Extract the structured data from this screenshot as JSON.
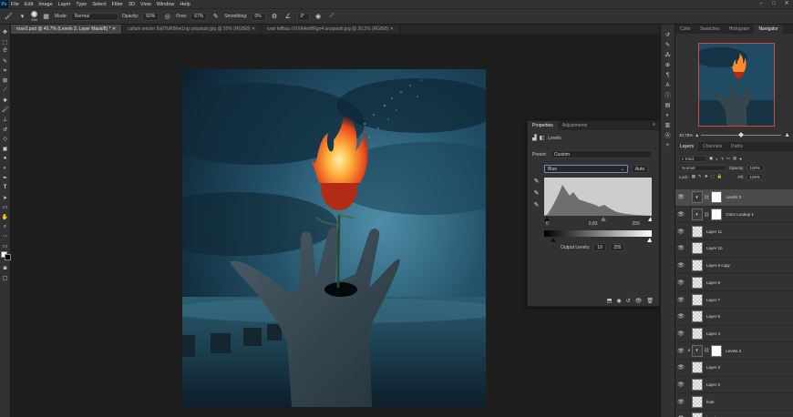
{
  "menubar": {
    "logo": "Ps",
    "items": [
      "File",
      "Edit",
      "Image",
      "Layer",
      "Type",
      "Select",
      "Filter",
      "3D",
      "View",
      "Window",
      "Help"
    ]
  },
  "options_bar": {
    "brush_size": "194",
    "mode_label": "Mode:",
    "mode_value": "Normal",
    "opacity_label": "Opacity:",
    "opacity_value": "60%",
    "flow_label": "Flow:",
    "flow_value": "67%",
    "smoothing_label": "Smoothing:",
    "smoothing_value": "0%",
    "angle_value": "0°"
  },
  "tabs": [
    {
      "label": "rose2.psd @ 40.7% (Levels 3, Layer Mask/8) *",
      "active": true
    },
    {
      "label": "callum wexler 8a6TbRBhw1ng unsplash.jpg @ 50% (RGB/8)",
      "active": false
    },
    {
      "label": "ivan leffbau 0VXAAm8Rgn4 unsplash.jpg @ 20.2% (RGB/8)",
      "active": false
    }
  ],
  "properties": {
    "tab_properties": "Properties",
    "tab_adjustments": "Adjustments",
    "header": "Levels",
    "preset_label": "Preset:",
    "preset_value": "Custom",
    "channel_value": "Blue",
    "auto_button": "Auto",
    "input_black": "0",
    "input_gamma": "0,83",
    "input_white": "255",
    "output_label": "Output Levels:",
    "output_black": "19",
    "output_white": "255"
  },
  "navigator": {
    "tabs": [
      "Color",
      "Swatches",
      "Histogram",
      "Navigator"
    ],
    "active_tab": "Navigator",
    "zoom": "40,78%"
  },
  "layers_panel": {
    "tabs": [
      "Layers",
      "Channels",
      "Paths"
    ],
    "active_tab": "Layers",
    "filter_kind": "Kind",
    "blend_mode": "Normal",
    "opacity_label": "Opacity:",
    "opacity_value": "100%",
    "lock_label": "Lock:",
    "fill_label": "Fill:",
    "fill_value": "100%",
    "layers": [
      {
        "name": "Levels 3",
        "type": "adjustment",
        "selected": true,
        "clip": false
      },
      {
        "name": "Color Lookup 1",
        "type": "adjustment",
        "selected": false,
        "clip": false
      },
      {
        "name": "Layer 11",
        "type": "pixel",
        "selected": false,
        "clip": false
      },
      {
        "name": "Layer 10",
        "type": "pixel",
        "selected": false,
        "clip": false
      },
      {
        "name": "Layer 8 copy",
        "type": "pixel",
        "selected": false,
        "clip": false
      },
      {
        "name": "Layer 8",
        "type": "pixel",
        "selected": false,
        "clip": false
      },
      {
        "name": "Layer 7",
        "type": "pixel",
        "selected": false,
        "clip": false
      },
      {
        "name": "Layer 5",
        "type": "pixel",
        "selected": false,
        "clip": false
      },
      {
        "name": "Layer 4",
        "type": "pixel",
        "selected": false,
        "clip": false
      },
      {
        "name": "Levels 2",
        "type": "adjustment",
        "selected": false,
        "clip": true
      },
      {
        "name": "Layer 3",
        "type": "pixel",
        "selected": false,
        "clip": false
      },
      {
        "name": "Layer 2",
        "type": "pixel",
        "selected": false,
        "clip": false
      },
      {
        "name": "hole",
        "type": "pixel",
        "selected": false,
        "clip": false
      },
      {
        "name": "hand",
        "type": "pixel",
        "selected": false,
        "clip": false
      }
    ]
  },
  "colors": {
    "accent_red": "#e0443a",
    "panel_bg": "#323232",
    "canvas_bg": "#1e1e1e"
  }
}
